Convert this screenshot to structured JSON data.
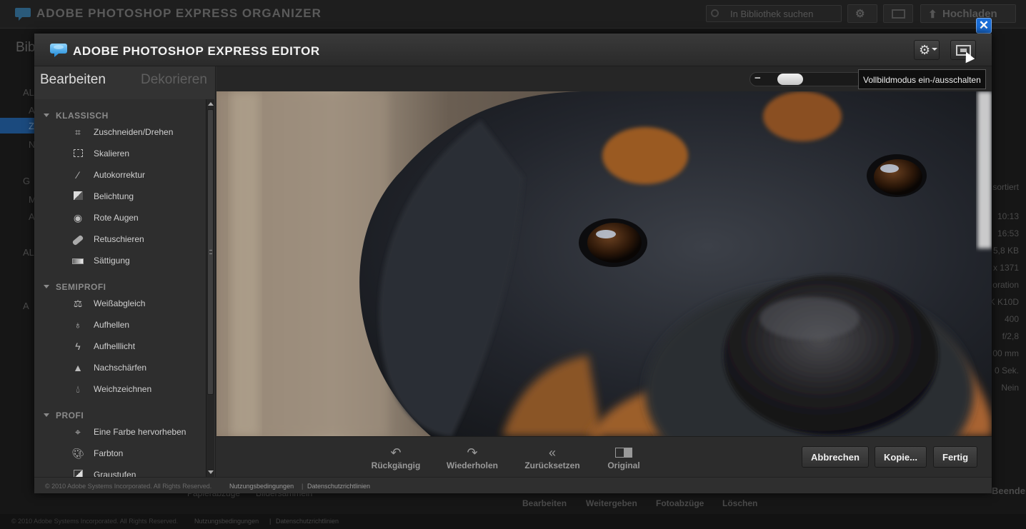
{
  "organizer": {
    "title": "ADOBE PHOTOSHOP EXPRESS ORGANIZER",
    "search_placeholder": "In Bibliothek suchen",
    "upload_label": "Hochladen",
    "library_heading": "Bib",
    "left_fragments": [
      "AL",
      "A",
      "Z",
      "N",
      "G",
      "M",
      "A",
      "AL",
      "A"
    ],
    "right_meta": [
      "sortiert",
      "10:13",
      "16:53",
      "5,8 KB",
      "x 1371",
      "oration",
      "K K10D",
      "400",
      "f/2,8",
      "00 mm",
      "0 Sek.",
      "Nein"
    ],
    "bottom_actions": [
      "Bearbeiten",
      "Weitergeben",
      "Fotoabzüge",
      "Löschen"
    ],
    "beenden": "Beenden",
    "bottom_left": [
      "Papierabzüge",
      "Bildersammeln"
    ],
    "footer_copyright": "© 2010 Adobe Systems Incorporated. All Rights Reserved.",
    "footer_links": [
      "Nutzungsbedingungen",
      "|",
      "Datenschutzrichtlinien"
    ]
  },
  "editor": {
    "title": "ADOBE PHOTOSHOP EXPRESS EDITOR",
    "tabs": [
      {
        "label": "Bearbeiten",
        "active": true
      },
      {
        "label": "Dekorieren",
        "active": false
      }
    ],
    "sections": [
      {
        "label": "KLASSISCH",
        "tools": [
          {
            "label": "Zuschneiden/Drehen",
            "icon": "crop-icon"
          },
          {
            "label": "Skalieren",
            "icon": "resize-icon"
          },
          {
            "label": "Autokorrektur",
            "icon": "magic-wand-icon"
          },
          {
            "label": "Belichtung",
            "icon": "exposure-icon"
          },
          {
            "label": "Rote Augen",
            "icon": "eye-icon"
          },
          {
            "label": "Retuschieren",
            "icon": "bandage-icon"
          },
          {
            "label": "Sättigung",
            "icon": "saturation-icon"
          }
        ]
      },
      {
        "label": "SEMIPROFI",
        "tools": [
          {
            "label": "Weißabgleich",
            "icon": "scale-icon"
          },
          {
            "label": "Aufhellen",
            "icon": "bulb-icon"
          },
          {
            "label": "Aufhelllicht",
            "icon": "lightning-icon"
          },
          {
            "label": "Nachschärfen",
            "icon": "sharpen-icon"
          },
          {
            "label": "Weichzeichnen",
            "icon": "drop-icon"
          }
        ]
      },
      {
        "label": "PROFI",
        "tools": [
          {
            "label": "Eine Farbe hervorheben",
            "icon": "crosshair-icon"
          },
          {
            "label": "Farbton",
            "icon": "palette-icon"
          },
          {
            "label": "Graustufen",
            "icon": "grayscale-icon"
          }
        ]
      }
    ],
    "zoom_level": 0.2,
    "tooltip": "Vollbildmodus ein-/ausschalten",
    "actions": [
      {
        "label": "Rückgängig",
        "icon": "undo-icon"
      },
      {
        "label": "Wiederholen",
        "icon": "redo-icon"
      },
      {
        "label": "Zurücksetzen",
        "icon": "reset-icon"
      },
      {
        "label": "Original",
        "icon": "original-icon"
      }
    ],
    "buttons": {
      "cancel": "Abbrechen",
      "copy": "Kopie...",
      "done": "Fertig"
    },
    "footer": {
      "copyright": "© 2010 Adobe Systems Incorporated. All Rights Reserved.",
      "terms": "Nutzungsbedingungen",
      "separator": "|",
      "privacy": "Datenschutzrichtlinien"
    }
  },
  "colors": {
    "accent_blue": "#1a6ed8",
    "logo_blue": "#3aa6e8"
  }
}
